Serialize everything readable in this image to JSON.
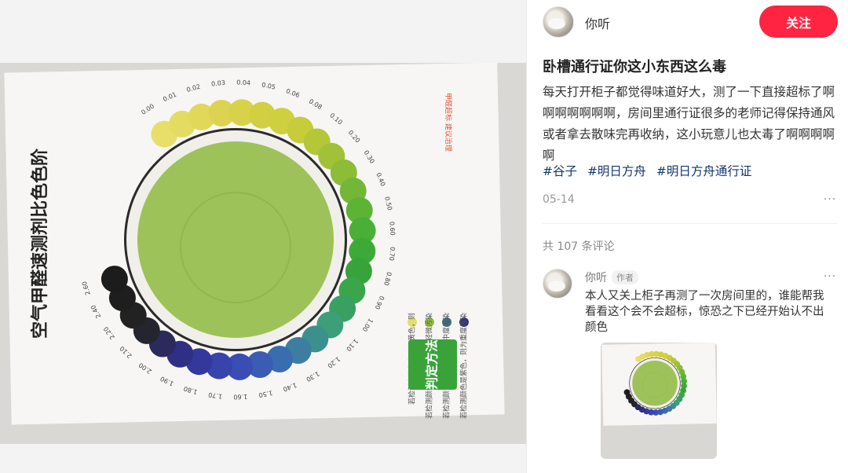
{
  "photo": {
    "card": {
      "heading": "空气甲醛速测剂比色色阶",
      "method_label": "判定方法",
      "ticks": [
        "0.00",
        "0.01",
        "0.02",
        "0.03",
        "0.04",
        "0.05",
        "0.06",
        "0.08",
        "0.10",
        "0.20",
        "0.30",
        "0.40",
        "0.50",
        "0.60",
        "0.70",
        "0.80",
        "0.90",
        "1.00",
        "1.10",
        "1.20",
        "1.30",
        "1.40",
        "1.50",
        "1.60",
        "1.70",
        "1.80",
        "1.90",
        "2.00",
        "2.10",
        "2.20",
        "2.40",
        "2.60"
      ],
      "ring_colors": [
        "#e8df6a",
        "#e4dc62",
        "#e1d85a",
        "#dcd451",
        "#d8d24a",
        "#d3cf43",
        "#cfd03f",
        "#c6cc3a",
        "#b5c637",
        "#a1c138",
        "#8dbd37",
        "#74b737",
        "#5db336",
        "#4aaf36",
        "#3daa37",
        "#38a23b",
        "#39a64a",
        "#3a9f63",
        "#3d9e7a",
        "#3d8f8d",
        "#3b7ea2",
        "#3a6cb0",
        "#3a5cb3",
        "#3a4db3",
        "#3744ab",
        "#33399c",
        "#302f86",
        "#2a2a5c",
        "#252530",
        "#222",
        "#1e1e1e",
        "#1c1c1c"
      ],
      "legend_rows": [
        {
          "text": "若检测出的颜色是淡黄色，则",
          "dot": "#e3df6b"
        },
        {
          "text": "若检测颜色是绿色，则为轻微污染",
          "dot": "#8fbf3a"
        },
        {
          "text": "若检测颜色是蓝色，则为中度污染",
          "dot": "#3b6f7e"
        },
        {
          "text": "若检测颜色是紫色，则为重度污染",
          "dot": "#33337a"
        }
      ],
      "stamp": "甲醛超标 建议治理",
      "brand_colors": {
        "method_bg": "#39a33a",
        "liquid": "#9ec25a"
      }
    }
  },
  "author": {
    "name": "你听",
    "follow_label": "关注"
  },
  "note": {
    "title": "卧槽通行证你这小东西这么毒",
    "body": "每天打开柜子都觉得味道好大，测了一下直接超标了啊啊啊啊啊啊啊，房间里通行证很多的老师记得保持通风或者拿去散味完再收纳，这小玩意儿也太毒了啊啊啊啊啊",
    "tags": [
      "#谷子",
      "#明日方舟",
      "#明日方舟通行证"
    ],
    "date": "05-14",
    "more_icon": "more-dots-icon"
  },
  "comments": {
    "count_label": "共 107 条评论",
    "items": [
      {
        "name": "你听",
        "badge": "作者",
        "text": "本人又关上柜子再测了一次房间里的，谁能帮我看看这个会不会超标，惊恐之下已经开始认不出颜色"
      }
    ]
  },
  "colors": {
    "accent": "#ff2442",
    "tag": "#13386c",
    "muted": "#999999"
  }
}
